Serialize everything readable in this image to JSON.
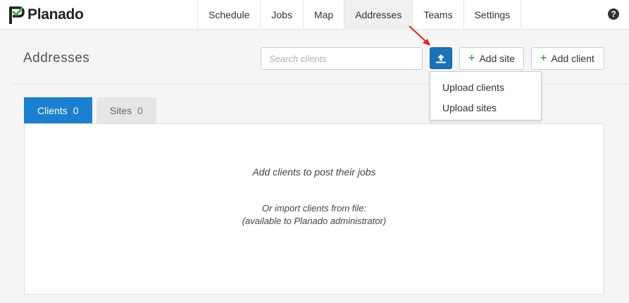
{
  "app": {
    "name": "Planado"
  },
  "nav": {
    "items": [
      {
        "label": "Schedule"
      },
      {
        "label": "Jobs"
      },
      {
        "label": "Map"
      },
      {
        "label": "Addresses",
        "active": true
      },
      {
        "label": "Teams"
      },
      {
        "label": "Settings"
      }
    ],
    "help_label": "?"
  },
  "page": {
    "title": "Addresses"
  },
  "search": {
    "placeholder": "Search clients",
    "value": ""
  },
  "toolbar": {
    "upload_icon": "upload-icon",
    "add_site_label": "Add site",
    "add_client_label": "Add client",
    "plus_glyph": "+"
  },
  "upload_menu": {
    "items": [
      {
        "label": "Upload clients"
      },
      {
        "label": "Upload sites"
      }
    ]
  },
  "tabs": [
    {
      "label": "Clients",
      "count": "0",
      "active": true
    },
    {
      "label": "Sites",
      "count": "0",
      "active": false
    }
  ],
  "empty_state": {
    "message": "Add clients to post their jobs",
    "import_line1": "Or import clients from file:",
    "import_line2": "(available to Planado administrator)"
  },
  "colors": {
    "accent": "#1a80d0",
    "upload_button": "#1a73b8",
    "plus": "#4caf50",
    "logo_green": "#3cb043",
    "annotation_arrow": "#e52420"
  }
}
